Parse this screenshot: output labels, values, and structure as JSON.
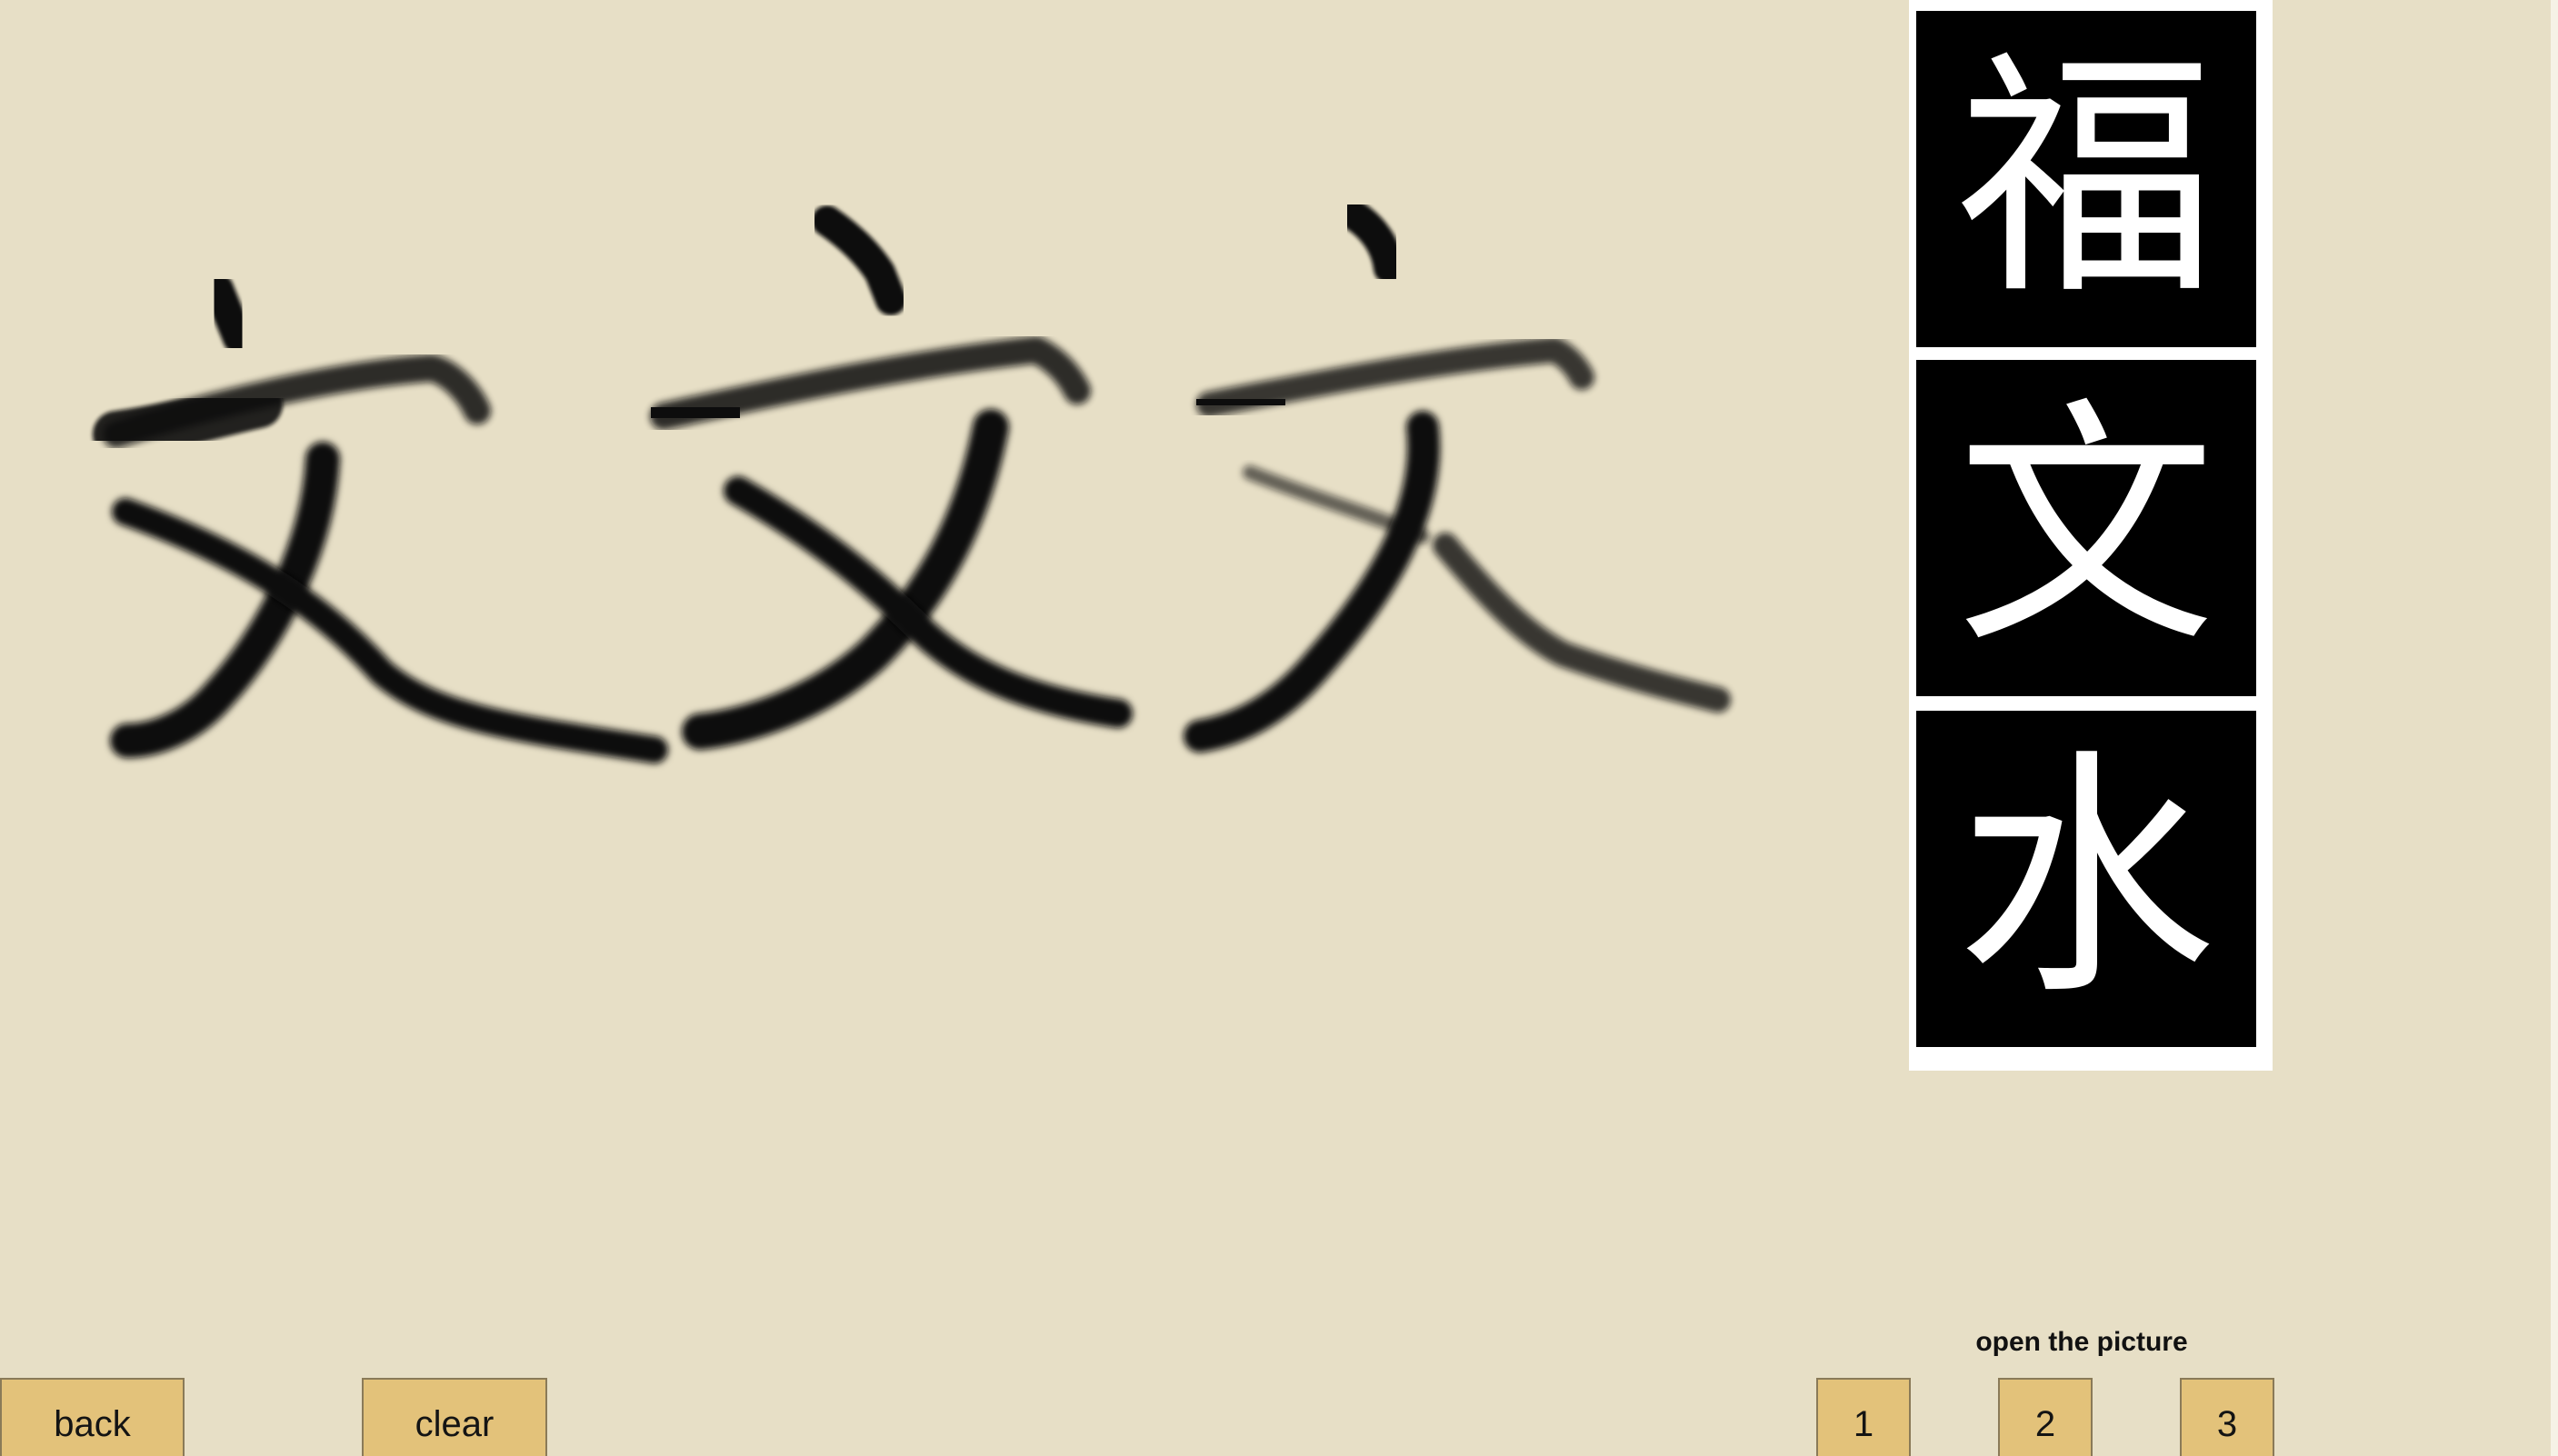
{
  "drawing": {
    "characters_drawn": [
      "文",
      "文",
      "文"
    ],
    "ink_color": "#111111"
  },
  "reference_panel": {
    "characters": [
      "福",
      "文",
      "水"
    ]
  },
  "controls": {
    "back_label": "back",
    "clear_label": "clear",
    "open_picture_label": "open the picture",
    "picture_buttons": [
      "1",
      "2",
      "3"
    ]
  },
  "colors": {
    "background": "#e7dfc6",
    "button": "#e3c27a",
    "tile": "#000000",
    "glyph": "#ffffff"
  }
}
